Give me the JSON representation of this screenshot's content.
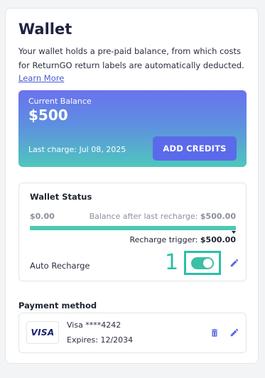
{
  "wallet": {
    "title": "Wallet",
    "description": "Your wallet holds a pre-paid balance, from which costs for ReturnGO return labels are automatically deducted.",
    "learn_more": "Learn More"
  },
  "balance": {
    "label": "Current Balance",
    "amount": "$500",
    "last_charge": "Last charge: Jul 08, 2025",
    "add_credits_label": "ADD CREDITS"
  },
  "status": {
    "title": "Wallet Status",
    "min_value": "$0.00",
    "after_recharge_label": "Balance after last recharge:",
    "after_recharge_value": "$500.00",
    "bar_fill_fraction": 1.0,
    "trigger_label": "Recharge trigger:",
    "trigger_value": "$500.00",
    "auto_recharge_label": "Auto Recharge",
    "auto_recharge_on": true,
    "annotation_number": "1",
    "toggle_icon": "toggle-switch-on",
    "edit_icon": "pencil-icon"
  },
  "payment": {
    "title": "Payment method",
    "brand": "VISA",
    "card_number": "Visa ****4242",
    "expires": "Expires: 12/2034",
    "delete_icon": "trash-icon",
    "edit_icon": "pencil-icon"
  },
  "colors": {
    "accent": "#5b6aea",
    "teal": "#2cbfa9",
    "gradient_top": "#6a72ee",
    "gradient_bottom": "#4ec7bd"
  }
}
